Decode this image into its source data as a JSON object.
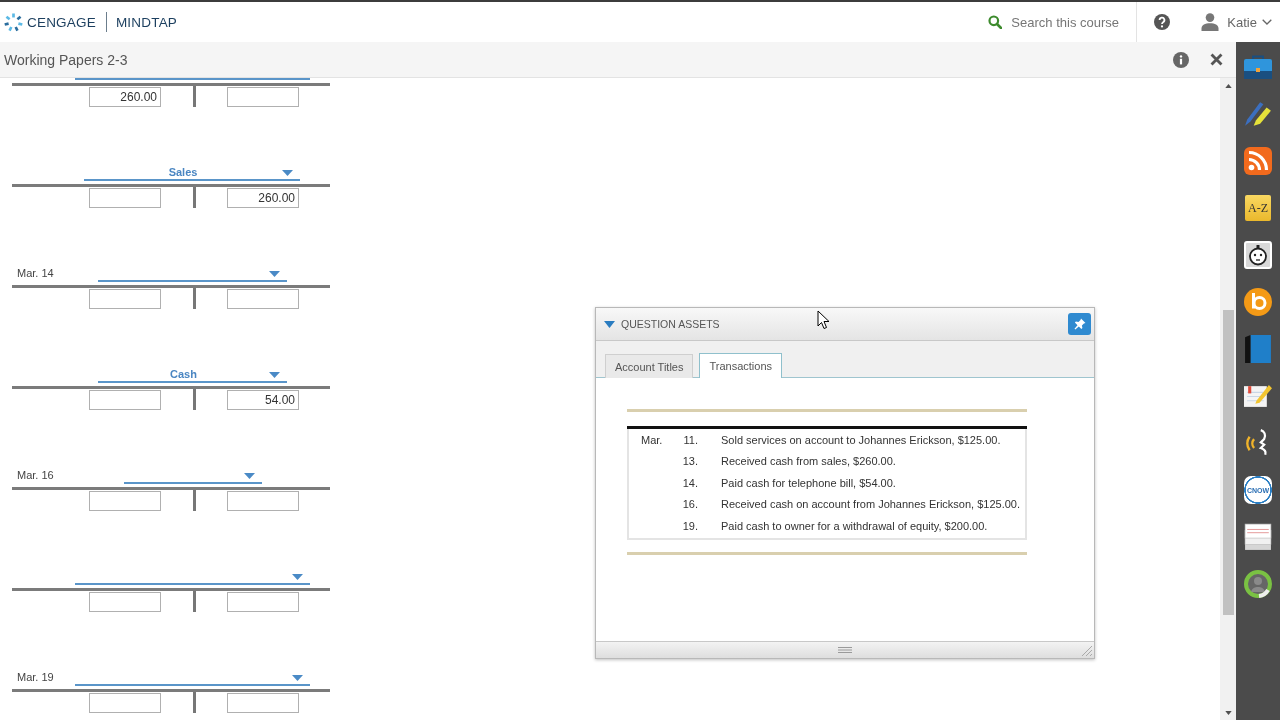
{
  "header": {
    "brand": "CENGAGE",
    "product": "MINDTAP",
    "search": {
      "placeholder": "Search this course"
    },
    "user": {
      "name": "Katie"
    }
  },
  "page": {
    "title": "Working Papers 2-3"
  },
  "t_accounts": [
    {
      "kind": "partial",
      "debit": "260.00"
    },
    {
      "kind": "full",
      "account": "Sales",
      "credit": "260.00"
    },
    {
      "kind": "full",
      "date": "Mar. 14"
    },
    {
      "kind": "full",
      "account": "Cash",
      "credit": "54.00"
    },
    {
      "kind": "full",
      "date": "Mar. 16"
    },
    {
      "kind": "full"
    },
    {
      "kind": "full",
      "date": "Mar. 19"
    }
  ],
  "question_assets": {
    "title": "QUESTION ASSETS",
    "expanded": true,
    "tabs": [
      {
        "label": "Account Titles",
        "selected": false
      },
      {
        "label": "Transactions",
        "selected": true
      }
    ],
    "transactions": [
      {
        "month": "Mar.",
        "day": "11.",
        "text": "Sold services on account to Johannes Erickson, $125.00."
      },
      {
        "day": "13.",
        "text": "Received cash from sales, $260.00."
      },
      {
        "day": "14.",
        "text": "Paid cash for telephone bill, $54.00."
      },
      {
        "day": "16.",
        "text": "Received cash on account from Johannes Erickson, $125.00."
      },
      {
        "day": "19.",
        "text": "Paid cash to owner for a withdrawal of equity, $200.00."
      }
    ]
  },
  "dock": [
    {
      "kind": "briefcase"
    },
    {
      "kind": "pencils"
    },
    {
      "kind": "feed"
    },
    {
      "kind": "letters",
      "text": "A-Z"
    },
    {
      "kind": "timer"
    },
    {
      "kind": "circle-logo"
    },
    {
      "kind": "book"
    },
    {
      "kind": "notepad"
    },
    {
      "kind": "sound"
    },
    {
      "kind": "badge",
      "text": "CNOW"
    },
    {
      "kind": "cards"
    },
    {
      "kind": "avatar"
    }
  ]
}
